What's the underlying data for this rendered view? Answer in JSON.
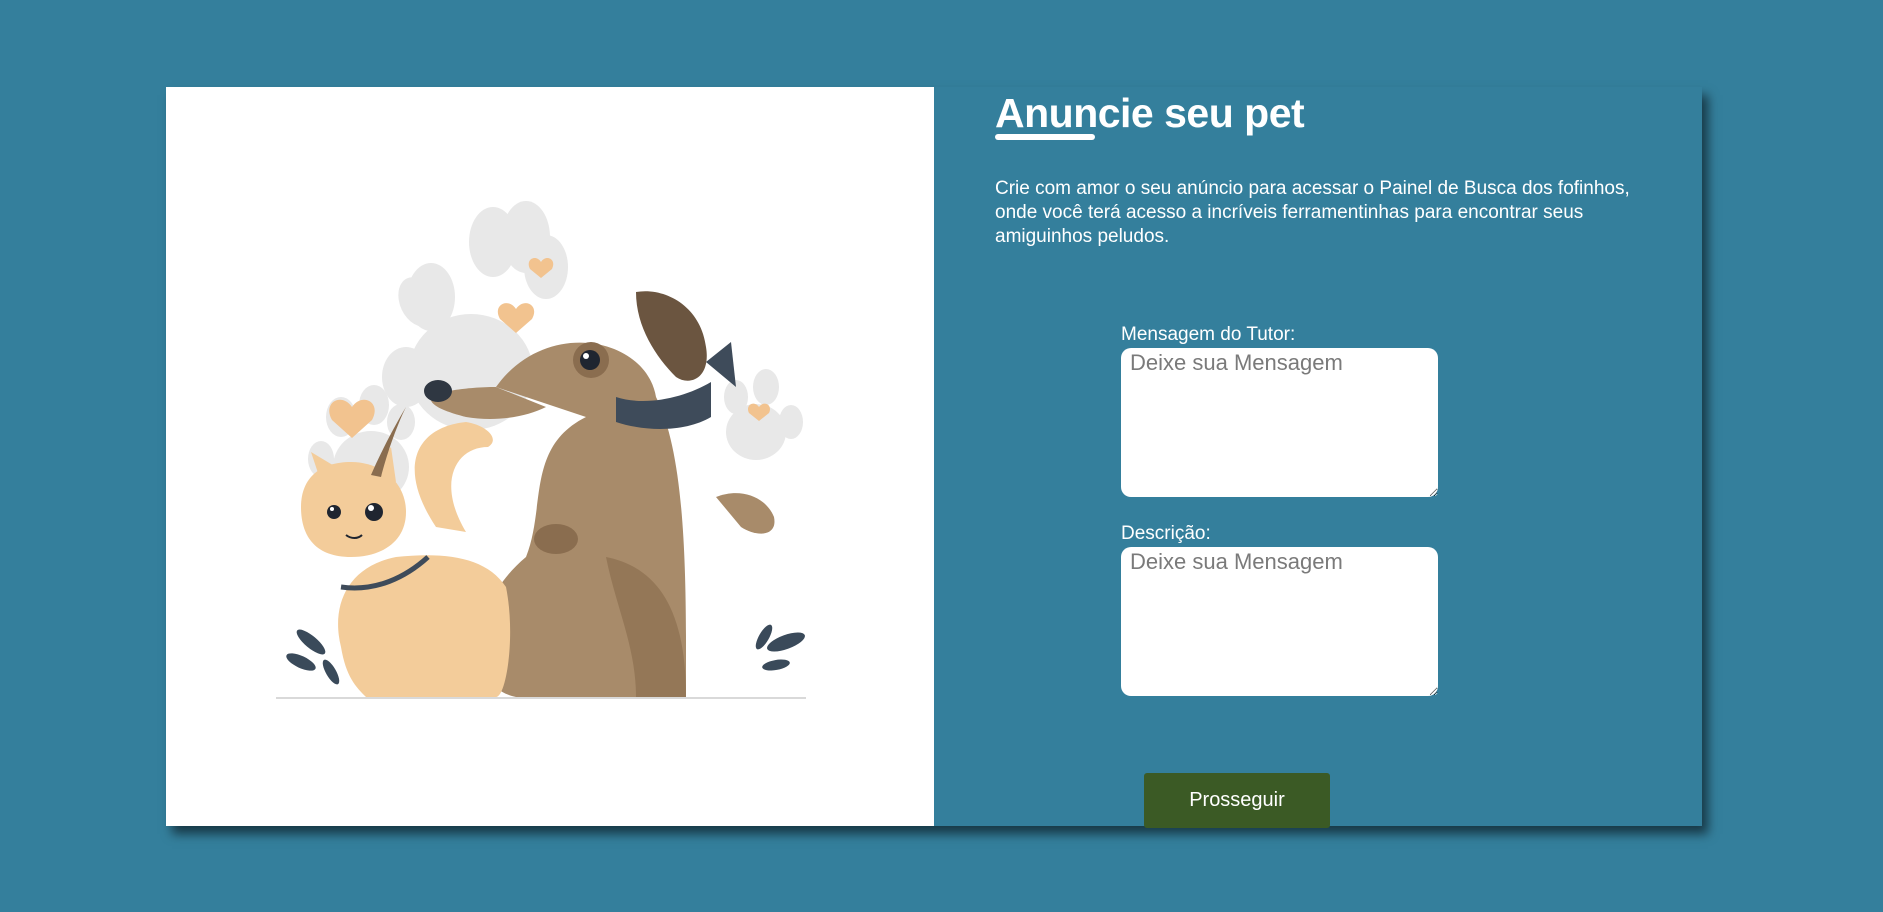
{
  "form": {
    "title": "Anuncie seu pet",
    "intro": "Crie com amor o seu anúncio para acessar o Painel de Busca dos fofinhos, onde você terá acesso a incríveis ferramentinhas para encontrar seus amiguinhos peludos.",
    "tutor_label": "Mensagem do Tutor:",
    "tutor_placeholder": "Deixe sua Mensagem",
    "desc_label": "Descrição:",
    "desc_placeholder": "Deixe sua Mensagem",
    "submit_label": "Prosseguir"
  },
  "illustration": {
    "subject": "cat and dog illustration",
    "icons": [
      "paw-print-icon",
      "heart-icon",
      "leaf-icon"
    ]
  },
  "colors": {
    "background": "#347f9c",
    "panel_left": "#ffffff",
    "button": "#3b5a25",
    "dog": "#a88b6a",
    "cat": "#f3cc9a",
    "paw": "#e8e8e8",
    "heart": "#f2c38f",
    "leaf": "#3a4a5a"
  }
}
